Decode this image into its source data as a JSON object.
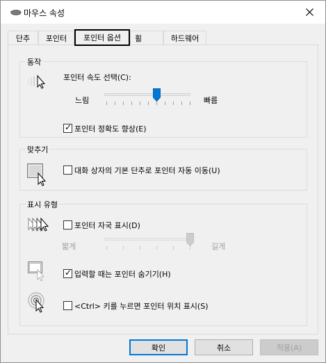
{
  "window": {
    "title": "마우스 속성",
    "close_icon": "close-icon"
  },
  "tabs": [
    {
      "label": "단추"
    },
    {
      "label": "포인터"
    },
    {
      "label": "포인터 옵션",
      "active": true
    },
    {
      "label": "휠"
    },
    {
      "label": "하드웨어"
    }
  ],
  "motion": {
    "legend": "동작",
    "speed_label": "포인터 속도 선택(C):",
    "slow": "느림",
    "fast": "빠름",
    "speed_value": 0.6,
    "precision_label": "포인터 정확도 향상(E)",
    "precision_checked": true
  },
  "snap": {
    "legend": "맞추기",
    "label": "대화 상자의 기본 단추로 포인터 자동 이동(U)",
    "checked": false
  },
  "visibility": {
    "legend": "표시 유형",
    "trails_label": "포인터 자국 표시(D)",
    "trails_checked": false,
    "short": "짧게",
    "long": "길게",
    "trails_value": 1.0,
    "hide_label": "입력할 때는 포인터 숨기기(H)",
    "hide_checked": true,
    "ctrl_label": "<Ctrl> 키를 누르면 포인터 위치 표시(S)",
    "ctrl_checked": false
  },
  "buttons": {
    "ok": "확인",
    "cancel": "취소",
    "apply": "적용(A)"
  },
  "colors": {
    "accent": "#0078d7",
    "thumb": "#0078d7",
    "disabled": "#a0a0a0"
  }
}
